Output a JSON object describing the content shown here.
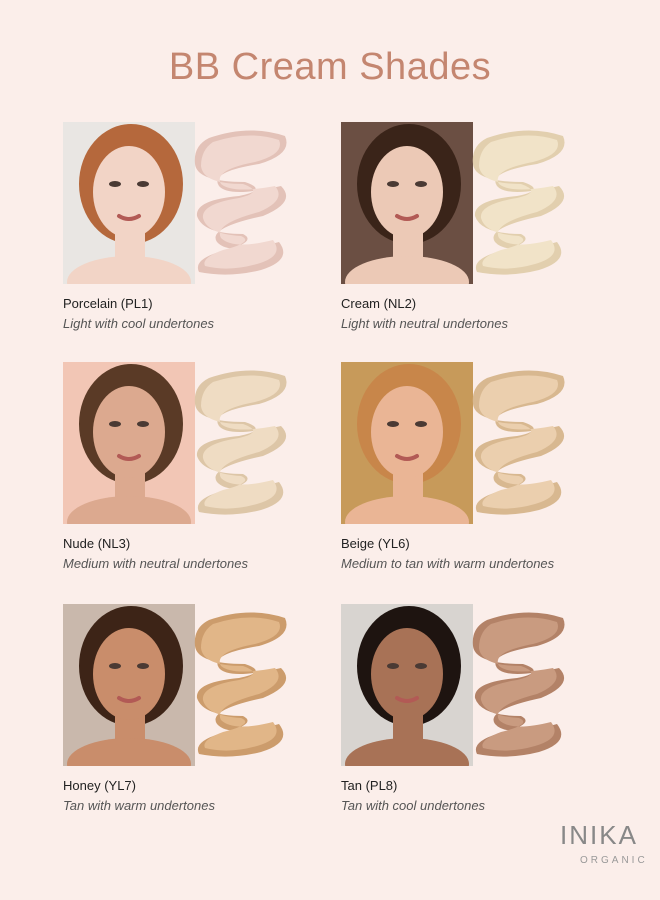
{
  "title": "BB Cream Shades",
  "shades": [
    {
      "name": "Porcelain (PL1)",
      "description": "Light with cool undertones",
      "swatch_color": "#f1d8d0",
      "swatch_shadow": "#e3c2b8",
      "photo_bg": "#e9e6e3",
      "skin": "#f2d4c6",
      "hair": "#b5683c"
    },
    {
      "name": "Cream (NL2)",
      "description": "Light with neutral undertones",
      "swatch_color": "#f1e3c8",
      "swatch_shadow": "#e2cfae",
      "photo_bg": "#6b4f43",
      "skin": "#ecc9b6",
      "hair": "#3a2419"
    },
    {
      "name": "Nude (NL3)",
      "description": "Medium with neutral undertones",
      "swatch_color": "#efdcc3",
      "swatch_shadow": "#ddc6a7",
      "photo_bg": "#f2c6b5",
      "skin": "#dca98f",
      "hair": "#5a3a26"
    },
    {
      "name": "Beige (YL6)",
      "description": "Medium to tan with warm undertones",
      "swatch_color": "#ebcfae",
      "swatch_shadow": "#d8b890",
      "photo_bg": "#c79a5a",
      "skin": "#eab595",
      "hair": "#c8864a"
    },
    {
      "name": "Honey (YL7)",
      "description": "Tan with warm undertones",
      "swatch_color": "#e1b688",
      "swatch_shadow": "#cc9c6c",
      "photo_bg": "#c9b8ac",
      "skin": "#c98d6b",
      "hair": "#3d2417"
    },
    {
      "name": "Tan (PL8)",
      "description": "Tan with cool undertones",
      "swatch_color": "#c99b80",
      "swatch_shadow": "#b38267",
      "photo_bg": "#d8d4d0",
      "skin": "#a87256",
      "hair": "#1e1410"
    }
  ],
  "brand": {
    "name": "INIKA",
    "tagline": "ORGANIC"
  }
}
